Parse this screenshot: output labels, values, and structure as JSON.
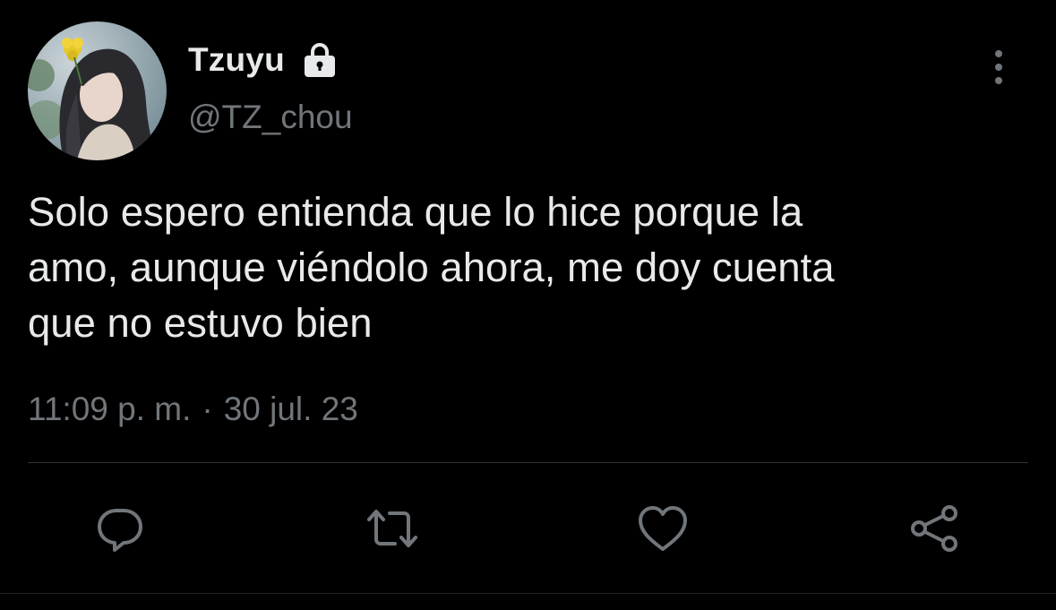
{
  "author": {
    "display_name": "Tzuyu",
    "handle": "@TZ_chou",
    "protected_icon": "lock-icon"
  },
  "tweet": {
    "text": "Solo espero entienda que lo hice porque la\namo, aunque viéndolo ahora, me doy cuenta\nque no estuvo bien",
    "time": "11:09 p. m.",
    "separator": "·",
    "date": "30 jul. 23"
  },
  "actions": [
    {
      "name": "reply",
      "icon": "reply-icon"
    },
    {
      "name": "retweet",
      "icon": "retweet-icon"
    },
    {
      "name": "like",
      "icon": "heart-icon"
    },
    {
      "name": "share",
      "icon": "share-icon"
    }
  ],
  "colors": {
    "background": "#000000",
    "primary_text": "#e7e9ea",
    "secondary_text": "#71767b",
    "icon": "#71767b",
    "divider": "#2f3336"
  }
}
